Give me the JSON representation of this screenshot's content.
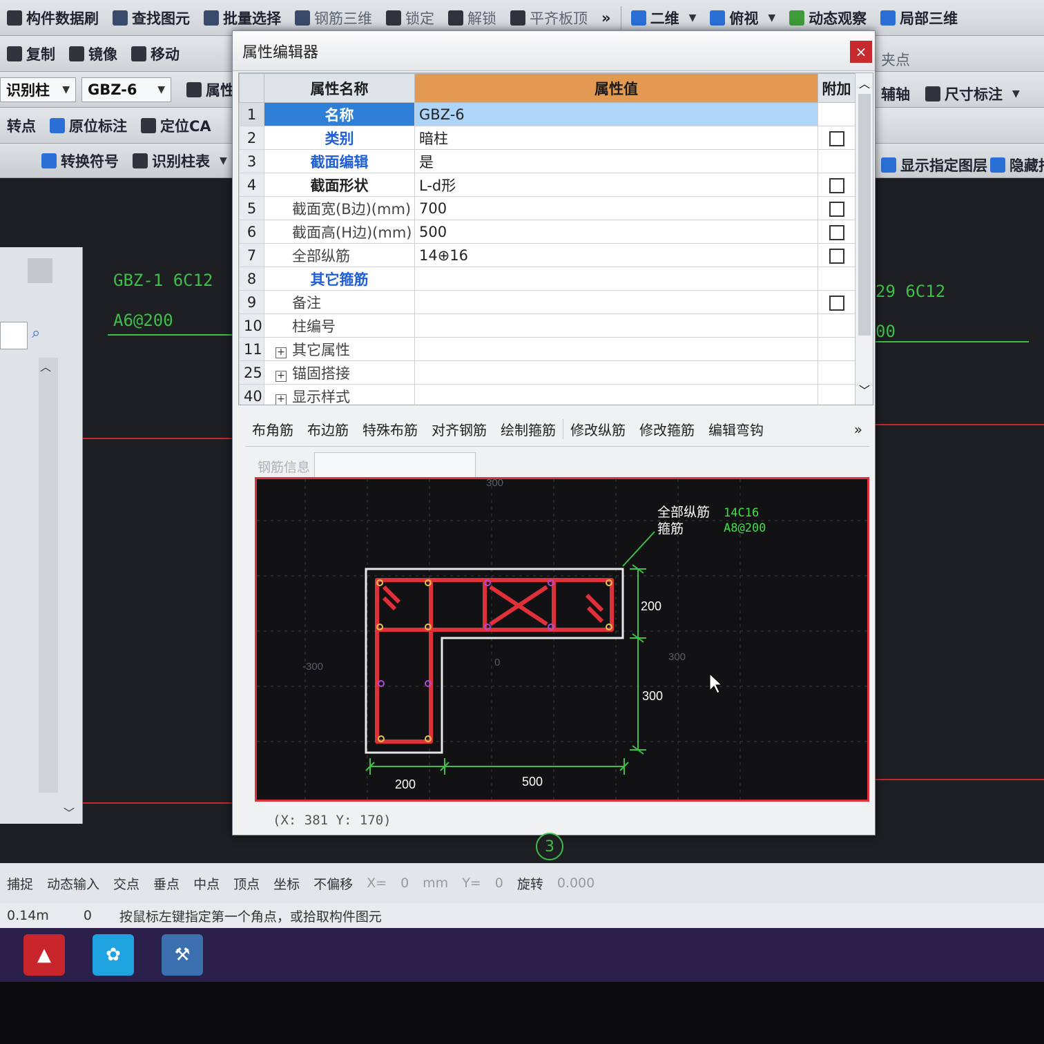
{
  "toolbar": {
    "row1": [
      "构件数据刷",
      "查找图元",
      "批量选择",
      "钢筋三维",
      "锁定",
      "解锁",
      "平齐板顶",
      "二维",
      "俯视",
      "动态观察",
      "局部三维"
    ],
    "row2": [
      "复制",
      "镜像",
      "移动"
    ],
    "component_type": "识别柱",
    "component_name": "GBZ-6",
    "properties_btn": "属性",
    "row4": [
      "转点",
      "原位标注",
      "定位CA"
    ],
    "row5": [
      "转换符号",
      "识别柱表"
    ],
    "right": {
      "snap_label": "夹点",
      "aux_axis": "辅轴",
      "dimension": "尺寸标注",
      "show_layer": "显示指定图层",
      "hide_layer": "隐藏指"
    }
  },
  "cad": {
    "left_label1": "GBZ-1  6C12",
    "left_label2": "A6@200",
    "right_label1": "29  6C12",
    "right_label2": "00",
    "page_badge": "3"
  },
  "dialog": {
    "title": "属性编辑器",
    "close": "×",
    "headers": {
      "name": "属性名称",
      "value": "属性值",
      "extra": "附加"
    },
    "rows": [
      {
        "num": "1",
        "name": "名称",
        "value": "GBZ-6",
        "style": "blue",
        "check": false,
        "selected": true,
        "expand": false
      },
      {
        "num": "2",
        "name": "类别",
        "value": "暗柱",
        "style": "blue",
        "check": true,
        "selected": false,
        "expand": false
      },
      {
        "num": "3",
        "name": "截面编辑",
        "value": "是",
        "style": "blue",
        "check": false,
        "selected": false,
        "expand": false
      },
      {
        "num": "4",
        "name": "截面形状",
        "value": "L-d形",
        "style": "dark",
        "check": true,
        "selected": false,
        "expand": false
      },
      {
        "num": "5",
        "name": "截面宽(B边)(mm)",
        "value": "700",
        "style": "plain",
        "check": true,
        "selected": false,
        "expand": false
      },
      {
        "num": "6",
        "name": "截面高(H边)(mm)",
        "value": "500",
        "style": "plain",
        "check": true,
        "selected": false,
        "expand": false
      },
      {
        "num": "7",
        "name": "全部纵筋",
        "value": "14⊕16",
        "style": "plain",
        "check": true,
        "selected": false,
        "expand": false
      },
      {
        "num": "8",
        "name": "其它箍筋",
        "value": "",
        "style": "blue",
        "check": false,
        "selected": false,
        "expand": false
      },
      {
        "num": "9",
        "name": "备注",
        "value": "",
        "style": "plain",
        "check": true,
        "selected": false,
        "expand": false
      },
      {
        "num": "10",
        "name": "柱编号",
        "value": "",
        "style": "plain",
        "check": false,
        "selected": false,
        "expand": false
      },
      {
        "num": "11",
        "name": "其它属性",
        "value": "",
        "style": "plain",
        "check": false,
        "selected": false,
        "expand": true
      },
      {
        "num": "25",
        "name": "锚固搭接",
        "value": "",
        "style": "plain",
        "check": false,
        "selected": false,
        "expand": true
      },
      {
        "num": "40",
        "name": "显示样式",
        "value": "",
        "style": "plain",
        "check": false,
        "selected": false,
        "expand": true
      }
    ],
    "rebar_tools": [
      "布角筋",
      "布边筋",
      "特殊布筋",
      "对齐钢筋",
      "绘制箍筋",
      "修改纵筋",
      "修改箍筋",
      "编辑弯钩"
    ],
    "rebar_info_label": "钢筋信息",
    "preview": {
      "callout_label1": "全部纵筋",
      "callout_label2": "箍筋",
      "callout_value1": "14C16",
      "callout_value2": "A8@200",
      "dim_200_v": "200",
      "dim_300_v": "300",
      "dim_200_h": "200",
      "dim_500_h": "500",
      "axis_300_left": "-300",
      "axis_300_right": "300",
      "axis_0": "0",
      "axis_300_top": "300"
    },
    "coord": "(X: 381 Y: 170)"
  },
  "snapbar": {
    "items": [
      "捕捉",
      "动态输入",
      "交点",
      "垂点",
      "中点",
      "顶点",
      "坐标",
      "不偏移"
    ],
    "x_label": "X=",
    "x_value": "0",
    "unit": "mm",
    "y_label": "Y=",
    "y_value": "0",
    "rotate": "旋转",
    "rotate_value": "0.000"
  },
  "statusbar": {
    "floor": "0.14m",
    "zero": "0",
    "hint": "按鼠标左键指定第一个角点，或拾取构件图元"
  },
  "colors": {
    "accent_orange": "#e29a52",
    "select_blue": "#2d7fd8",
    "rebar_red": "#e0303a",
    "cad_green": "#3fbf4a"
  }
}
